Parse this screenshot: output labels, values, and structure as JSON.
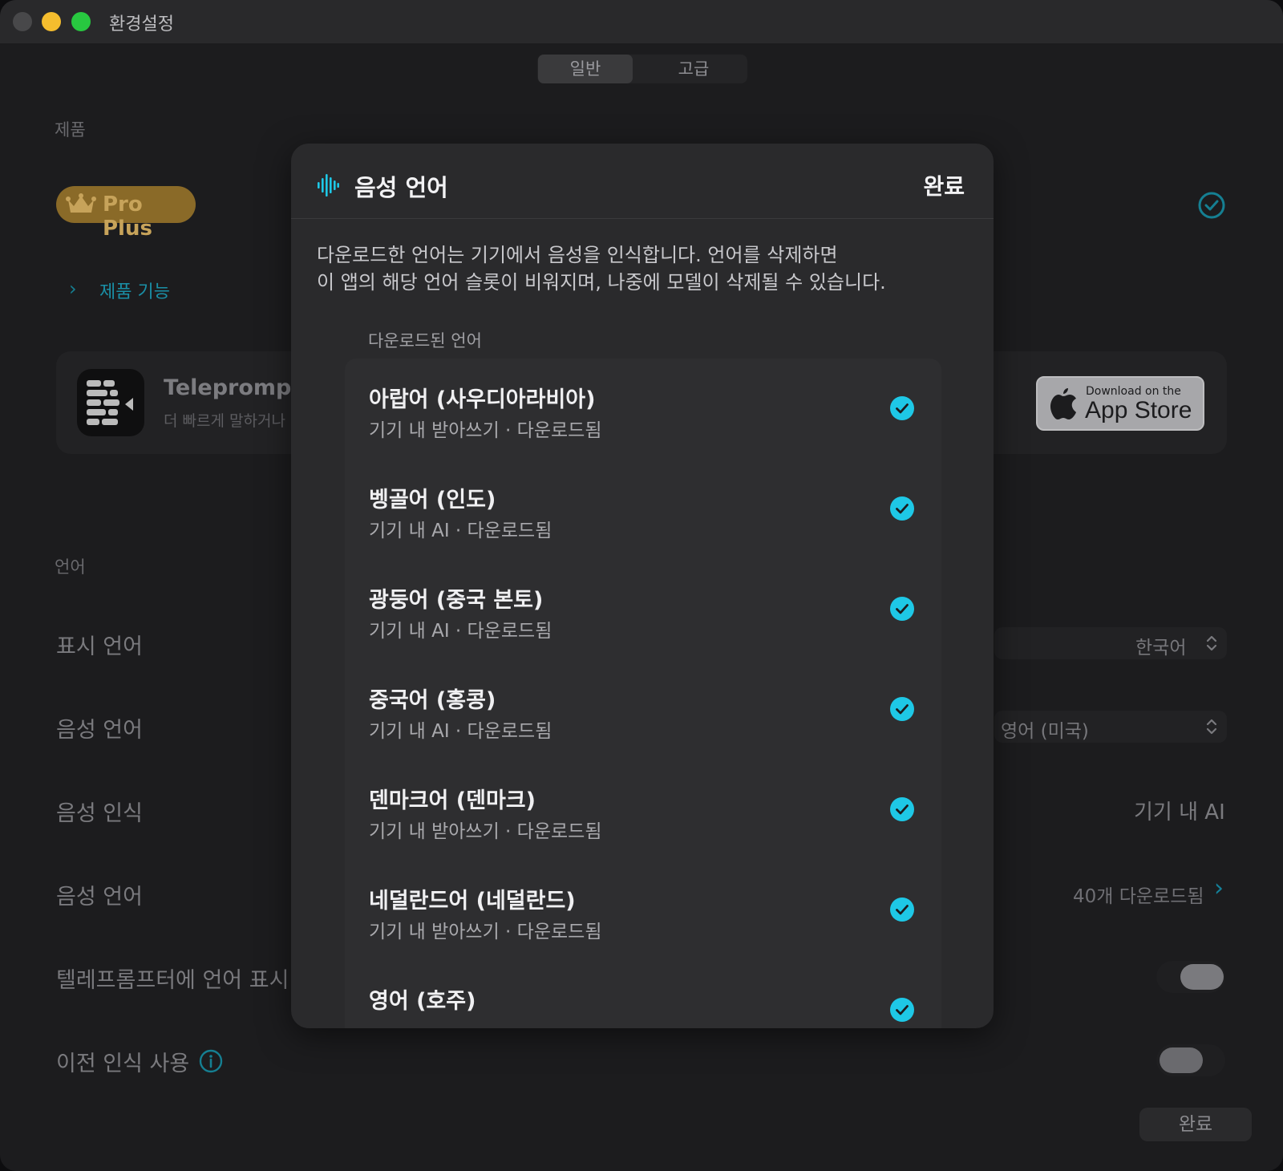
{
  "window": {
    "title": "환경설정"
  },
  "tabs": [
    {
      "label": "일반"
    },
    {
      "label": "고급"
    }
  ],
  "sections": {
    "product": "제품",
    "language": "언어"
  },
  "product": {
    "badge": "Pro Plus",
    "features_link": "제품 기능",
    "app_name": "Teleprompter",
    "app_desc": "더 빠르게 말하거나",
    "appstore_small": "Download on the",
    "appstore_big": "App Store"
  },
  "settings": {
    "display_language": {
      "label": "표시 언어",
      "value": "한국어"
    },
    "voice_language": {
      "label": "음성 언어",
      "value": "영어 (미국)"
    },
    "recognition": {
      "label": "음성 인식",
      "value": "기기 내 AI"
    },
    "voice_languages": {
      "label": "음성 언어",
      "value": "40개 다운로드됨"
    },
    "show_language": {
      "label": "텔레프롬프터에 언어 표시"
    },
    "previous_recognition": {
      "label": "이전 인식 사용"
    }
  },
  "done_button": "완료",
  "modal": {
    "title": "음성 언어",
    "done": "완료",
    "description_line1": "다운로드한 언어는 기기에서 음성을 인식합니다. 언어를 삭제하면",
    "description_line2": "이 앱의 해당 언어 슬롯이 비워지며, 나중에 모델이 삭제될 수 있습니다.",
    "group_label": "다운로드된 언어",
    "languages": [
      {
        "name": "아랍어 (사우디아라비아)",
        "sub": "기기 내 받아쓰기 · 다운로드됨"
      },
      {
        "name": "벵골어 (인도)",
        "sub": "기기 내 AI · 다운로드됨"
      },
      {
        "name": "광둥어 (중국 본토)",
        "sub": "기기 내 AI · 다운로드됨"
      },
      {
        "name": "중국어 (홍콩)",
        "sub": "기기 내 AI · 다운로드됨"
      },
      {
        "name": "덴마크어 (덴마크)",
        "sub": "기기 내 받아쓰기 · 다운로드됨"
      },
      {
        "name": "네덜란드어 (네덜란드)",
        "sub": "기기 내 받아쓰기 · 다운로드됨"
      },
      {
        "name": "영어 (호주)",
        "sub": ""
      }
    ]
  },
  "colors": {
    "accent": "#1ec8e6",
    "pro_badge": "#8a6a28"
  }
}
